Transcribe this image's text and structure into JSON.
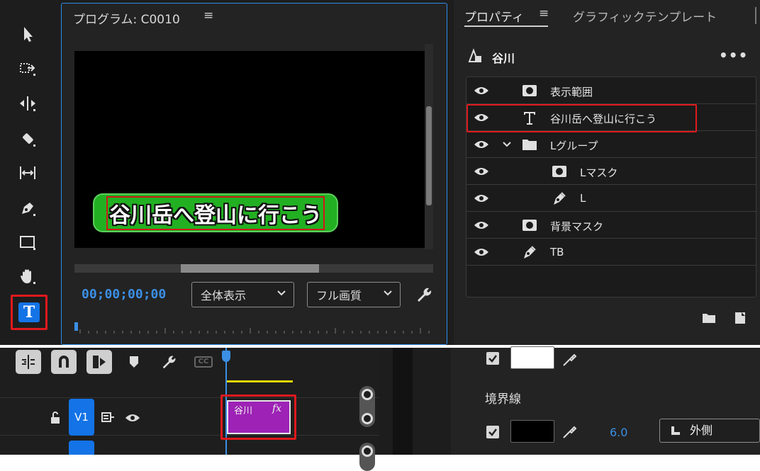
{
  "program_monitor": {
    "title": "プログラム: C0010",
    "menu_icon": "≡",
    "caption": "谷川岳へ登山に行こう",
    "timecode": "00;00;00;00",
    "zoom_select": "全体表示",
    "quality_select": "フル画質"
  },
  "properties": {
    "tab_active": "プロパティ",
    "tab_menu_icon": "≡",
    "tab_inactive": "グラフィックテンプレート",
    "object_name": "谷川",
    "more": "•••",
    "layers": [
      {
        "label": "表示範囲",
        "icon": "mask-icon"
      },
      {
        "label": "谷川岳へ登山に行こう",
        "icon": "text-icon"
      },
      {
        "label": "Lグループ",
        "icon": "folder-icon"
      },
      {
        "label": "Lマスク",
        "icon": "mask-icon"
      },
      {
        "label": "L",
        "icon": "pen-icon"
      },
      {
        "label": "背景マスク",
        "icon": "mask-icon"
      },
      {
        "label": "TB",
        "icon": "pen-icon"
      }
    ]
  },
  "timeline": {
    "track_label": "V1",
    "cc_label": "CC",
    "clip_name": "谷川",
    "clip_fx": "fx"
  },
  "essential": {
    "stroke_label": "境界線",
    "stroke_width": "6.0",
    "stroke_position": "外側"
  },
  "colors": {
    "accent_blue": "#1473e6",
    "highlight_red": "#e0191c",
    "caption_green": "#22b022",
    "clip_purple": "#9d22b5",
    "fill_white": "#ffffff",
    "stroke_black": "#000000"
  }
}
